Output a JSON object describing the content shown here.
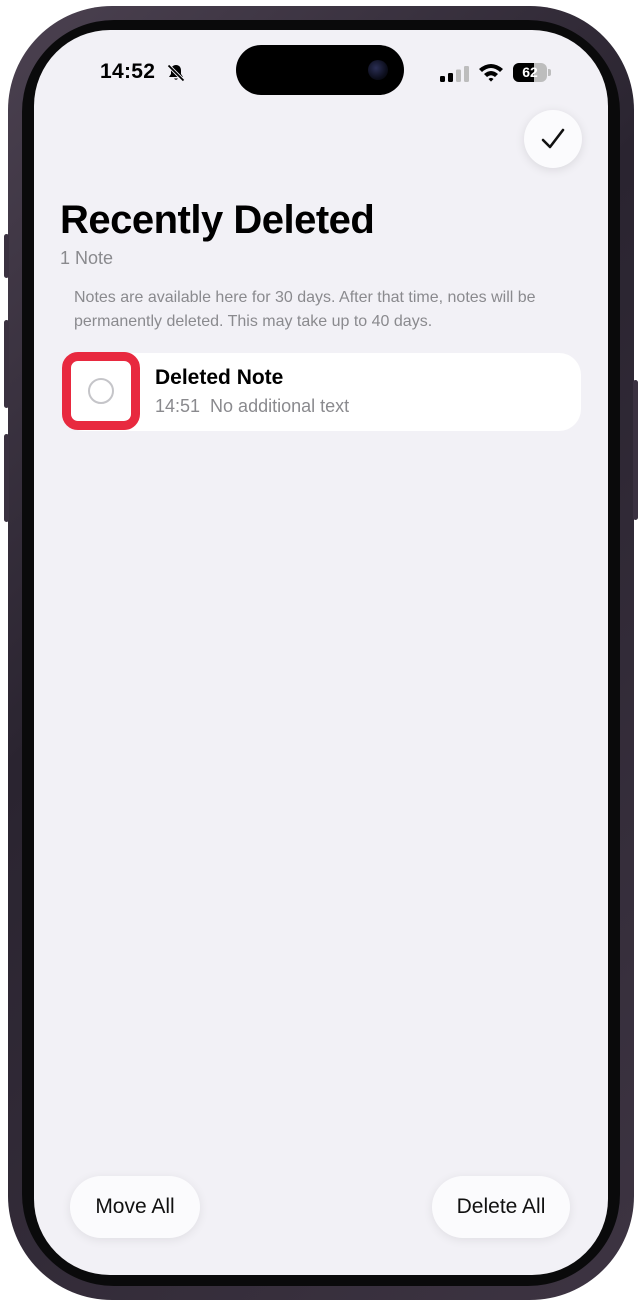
{
  "status_bar": {
    "time": "14:52",
    "battery_percent": "62",
    "battery_level": 0.62,
    "icons": [
      "bell-slash-icon",
      "cellular-signal-icon",
      "wifi-icon",
      "battery-icon"
    ]
  },
  "header": {
    "done_icon": "checkmark-icon",
    "title": "Recently Deleted",
    "subtitle": "1 Note"
  },
  "info_text": "Notes are available here for 30 days. After that time, notes will be permanently deleted. This may take up to 40 days.",
  "notes": [
    {
      "title": "Deleted Note",
      "time": "14:51",
      "preview": "No additional text",
      "selected": false
    }
  ],
  "colors": {
    "background": "#f2f1f6",
    "highlight": "#e8293f",
    "secondary_text": "#8a8a8e"
  },
  "toolbar": {
    "move_all_label": "Move All",
    "delete_all_label": "Delete All"
  }
}
